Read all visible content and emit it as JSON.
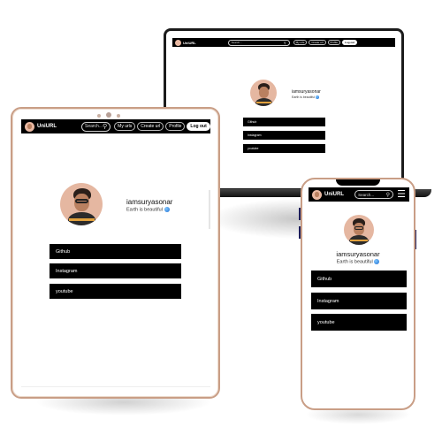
{
  "app": {
    "logo_text": "UniURL",
    "search_placeholder": "Search...",
    "nav": {
      "my_urls": "My urls",
      "create_url": "Create url",
      "profile": "Profile",
      "logout": "Log out"
    }
  },
  "profile": {
    "username": "iamsuryasonar",
    "bio": "Earth is beautiful"
  },
  "links": [
    {
      "label": "Github"
    },
    {
      "label": "Instagram"
    },
    {
      "label": "youtube"
    }
  ],
  "colors": {
    "navbar": "#000000",
    "link_bar": "#000000",
    "device_frame": "#c99e86",
    "laptop_frame": "#1b1b1b"
  },
  "icons": {
    "search": "search-icon",
    "menu": "hamburger-menu-icon",
    "bio_emoji": "globe-icon"
  }
}
